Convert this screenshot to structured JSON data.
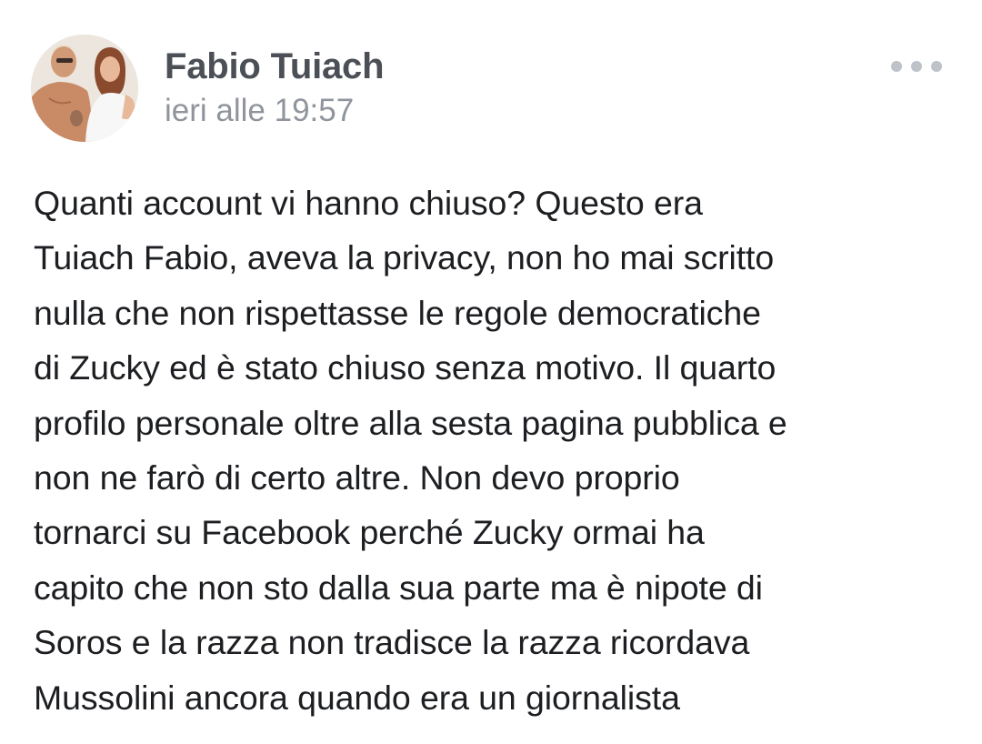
{
  "post": {
    "author": {
      "name": "Fabio Tuiach",
      "avatar_icon": "profile-photo"
    },
    "timestamp": "ieri alle 19:57",
    "more_icon": "more-options-icon",
    "text_lines": [
      "Quanti account vi hanno chiuso? Questo era",
      "Tuiach Fabio, aveva la privacy, non ho mai scritto",
      "nulla che non rispettasse le regole democratiche",
      "di Zucky ed è stato chiuso senza motivo. Il quarto",
      "profilo personale oltre alla sesta pagina pubblica e",
      "non ne farò di certo altre. Non devo proprio",
      "tornarci su Facebook perché Zucky ormai ha",
      "capito che non sto dalla sua parte ma è nipote di",
      "Soros e la razza non tradisce la razza ricordava",
      "Mussolini ancora quando era un giornalista"
    ]
  },
  "colors": {
    "name": "#4b4f56",
    "timestamp": "#90949c",
    "text": "#1c1e21",
    "dots": "#bec2c9",
    "background": "#ffffff"
  }
}
